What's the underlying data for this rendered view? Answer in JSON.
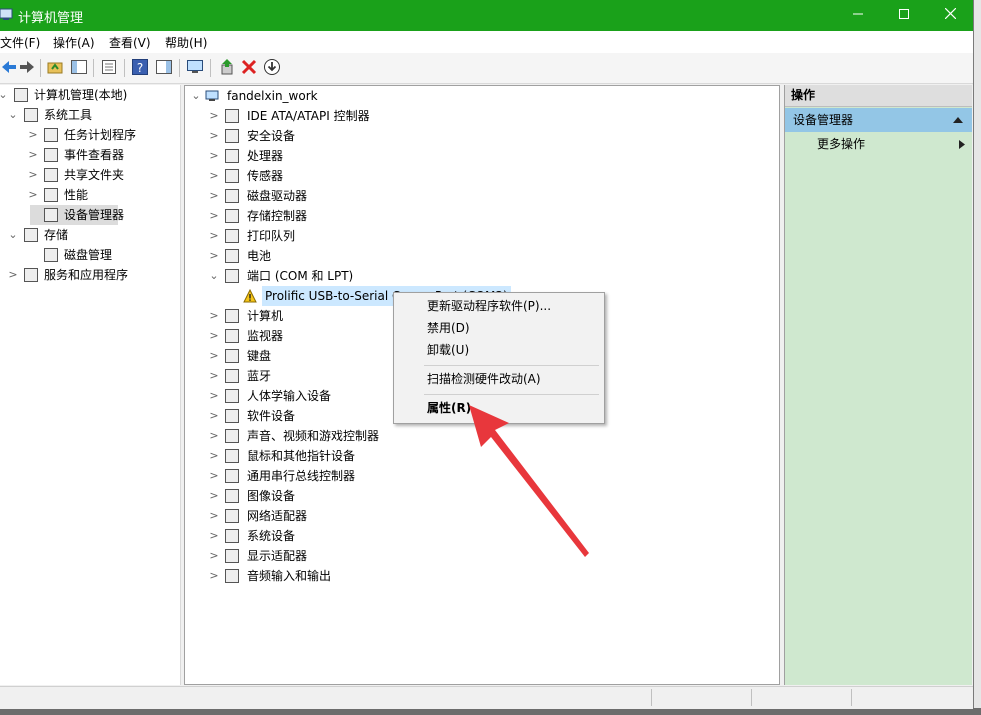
{
  "window": {
    "title": "计算机管理"
  },
  "menu": [
    "文件(F)",
    "操作(A)",
    "查看(V)",
    "帮助(H)"
  ],
  "left_tree": [
    {
      "label": "计算机管理(本地)",
      "level": 0,
      "expander": "⌄",
      "icon": "computer-manage-icon"
    },
    {
      "label": "系统工具",
      "level": 1,
      "expander": "⌄",
      "icon": "tools-icon"
    },
    {
      "label": "任务计划程序",
      "level": 2,
      "expander": ">",
      "icon": "clock-icon"
    },
    {
      "label": "事件查看器",
      "level": 2,
      "expander": ">",
      "icon": "event-viewer-icon"
    },
    {
      "label": "共享文件夹",
      "level": 2,
      "expander": ">",
      "icon": "shared-folder-icon"
    },
    {
      "label": "性能",
      "level": 2,
      "expander": ">",
      "icon": "performance-icon"
    },
    {
      "label": "设备管理器",
      "level": 2,
      "expander": "",
      "icon": "device-manager-icon",
      "selected": true
    },
    {
      "label": "存储",
      "level": 1,
      "expander": "⌄",
      "icon": "storage-icon"
    },
    {
      "label": "磁盘管理",
      "level": 2,
      "expander": "",
      "icon": "disk-manage-icon"
    },
    {
      "label": "服务和应用程序",
      "level": 1,
      "expander": ">",
      "icon": "services-icon"
    }
  ],
  "device_tree": {
    "root": "fandelxin_work",
    "items": [
      {
        "label": "IDE ATA/ATAPI 控制器",
        "expander": ">",
        "icon": "ide-icon"
      },
      {
        "label": "安全设备",
        "expander": ">",
        "icon": "security-device-icon"
      },
      {
        "label": "处理器",
        "expander": ">",
        "icon": "cpu-icon"
      },
      {
        "label": "传感器",
        "expander": ">",
        "icon": "sensor-icon"
      },
      {
        "label": "磁盘驱动器",
        "expander": ">",
        "icon": "disk-drive-icon"
      },
      {
        "label": "存储控制器",
        "expander": ">",
        "icon": "storage-controller-icon"
      },
      {
        "label": "打印队列",
        "expander": ">",
        "icon": "printer-icon"
      },
      {
        "label": "电池",
        "expander": ">",
        "icon": "battery-icon"
      },
      {
        "label": "端口 (COM 和 LPT)",
        "expander": "⌄",
        "icon": "port-icon"
      },
      {
        "label": "Prolific USB-to-Serial Comm Port (COM3)",
        "expander": "",
        "icon": "warning-icon",
        "child": true,
        "selected": true
      },
      {
        "label": "计算机",
        "expander": ">",
        "icon": "monitor-icon"
      },
      {
        "label": "监视器",
        "expander": ">",
        "icon": "monitor-icon"
      },
      {
        "label": "键盘",
        "expander": ">",
        "icon": "keyboard-icon"
      },
      {
        "label": "蓝牙",
        "expander": ">",
        "icon": "bluetooth-icon"
      },
      {
        "label": "人体学输入设备",
        "expander": ">",
        "icon": "hid-icon"
      },
      {
        "label": "软件设备",
        "expander": ">",
        "icon": "software-device-icon"
      },
      {
        "label": "声音、视频和游戏控制器",
        "expander": ">",
        "icon": "speaker-icon"
      },
      {
        "label": "鼠标和其他指针设备",
        "expander": ">",
        "icon": "mouse-icon"
      },
      {
        "label": "通用串行总线控制器",
        "expander": ">",
        "icon": "usb-icon"
      },
      {
        "label": "图像设备",
        "expander": ">",
        "icon": "camera-icon"
      },
      {
        "label": "网络适配器",
        "expander": ">",
        "icon": "network-icon"
      },
      {
        "label": "系统设备",
        "expander": ">",
        "icon": "system-device-icon"
      },
      {
        "label": "显示适配器",
        "expander": ">",
        "icon": "display-adapter-icon"
      },
      {
        "label": "音频输入和输出",
        "expander": ">",
        "icon": "audio-icon"
      }
    ]
  },
  "actions": {
    "header": "操作",
    "section": "设备管理器",
    "more": "更多操作"
  },
  "context_menu": {
    "update": "更新驱动程序软件(P)...",
    "disable": "禁用(D)",
    "uninstall": "卸载(U)",
    "scan": "扫描检测硬件改动(A)",
    "properties": "属性(R)"
  },
  "colors": {
    "titlebar": "#1aa11a",
    "selection": "#cce8ff",
    "actions_bg": "#cfe8cf",
    "arrow": "#e8373c"
  }
}
